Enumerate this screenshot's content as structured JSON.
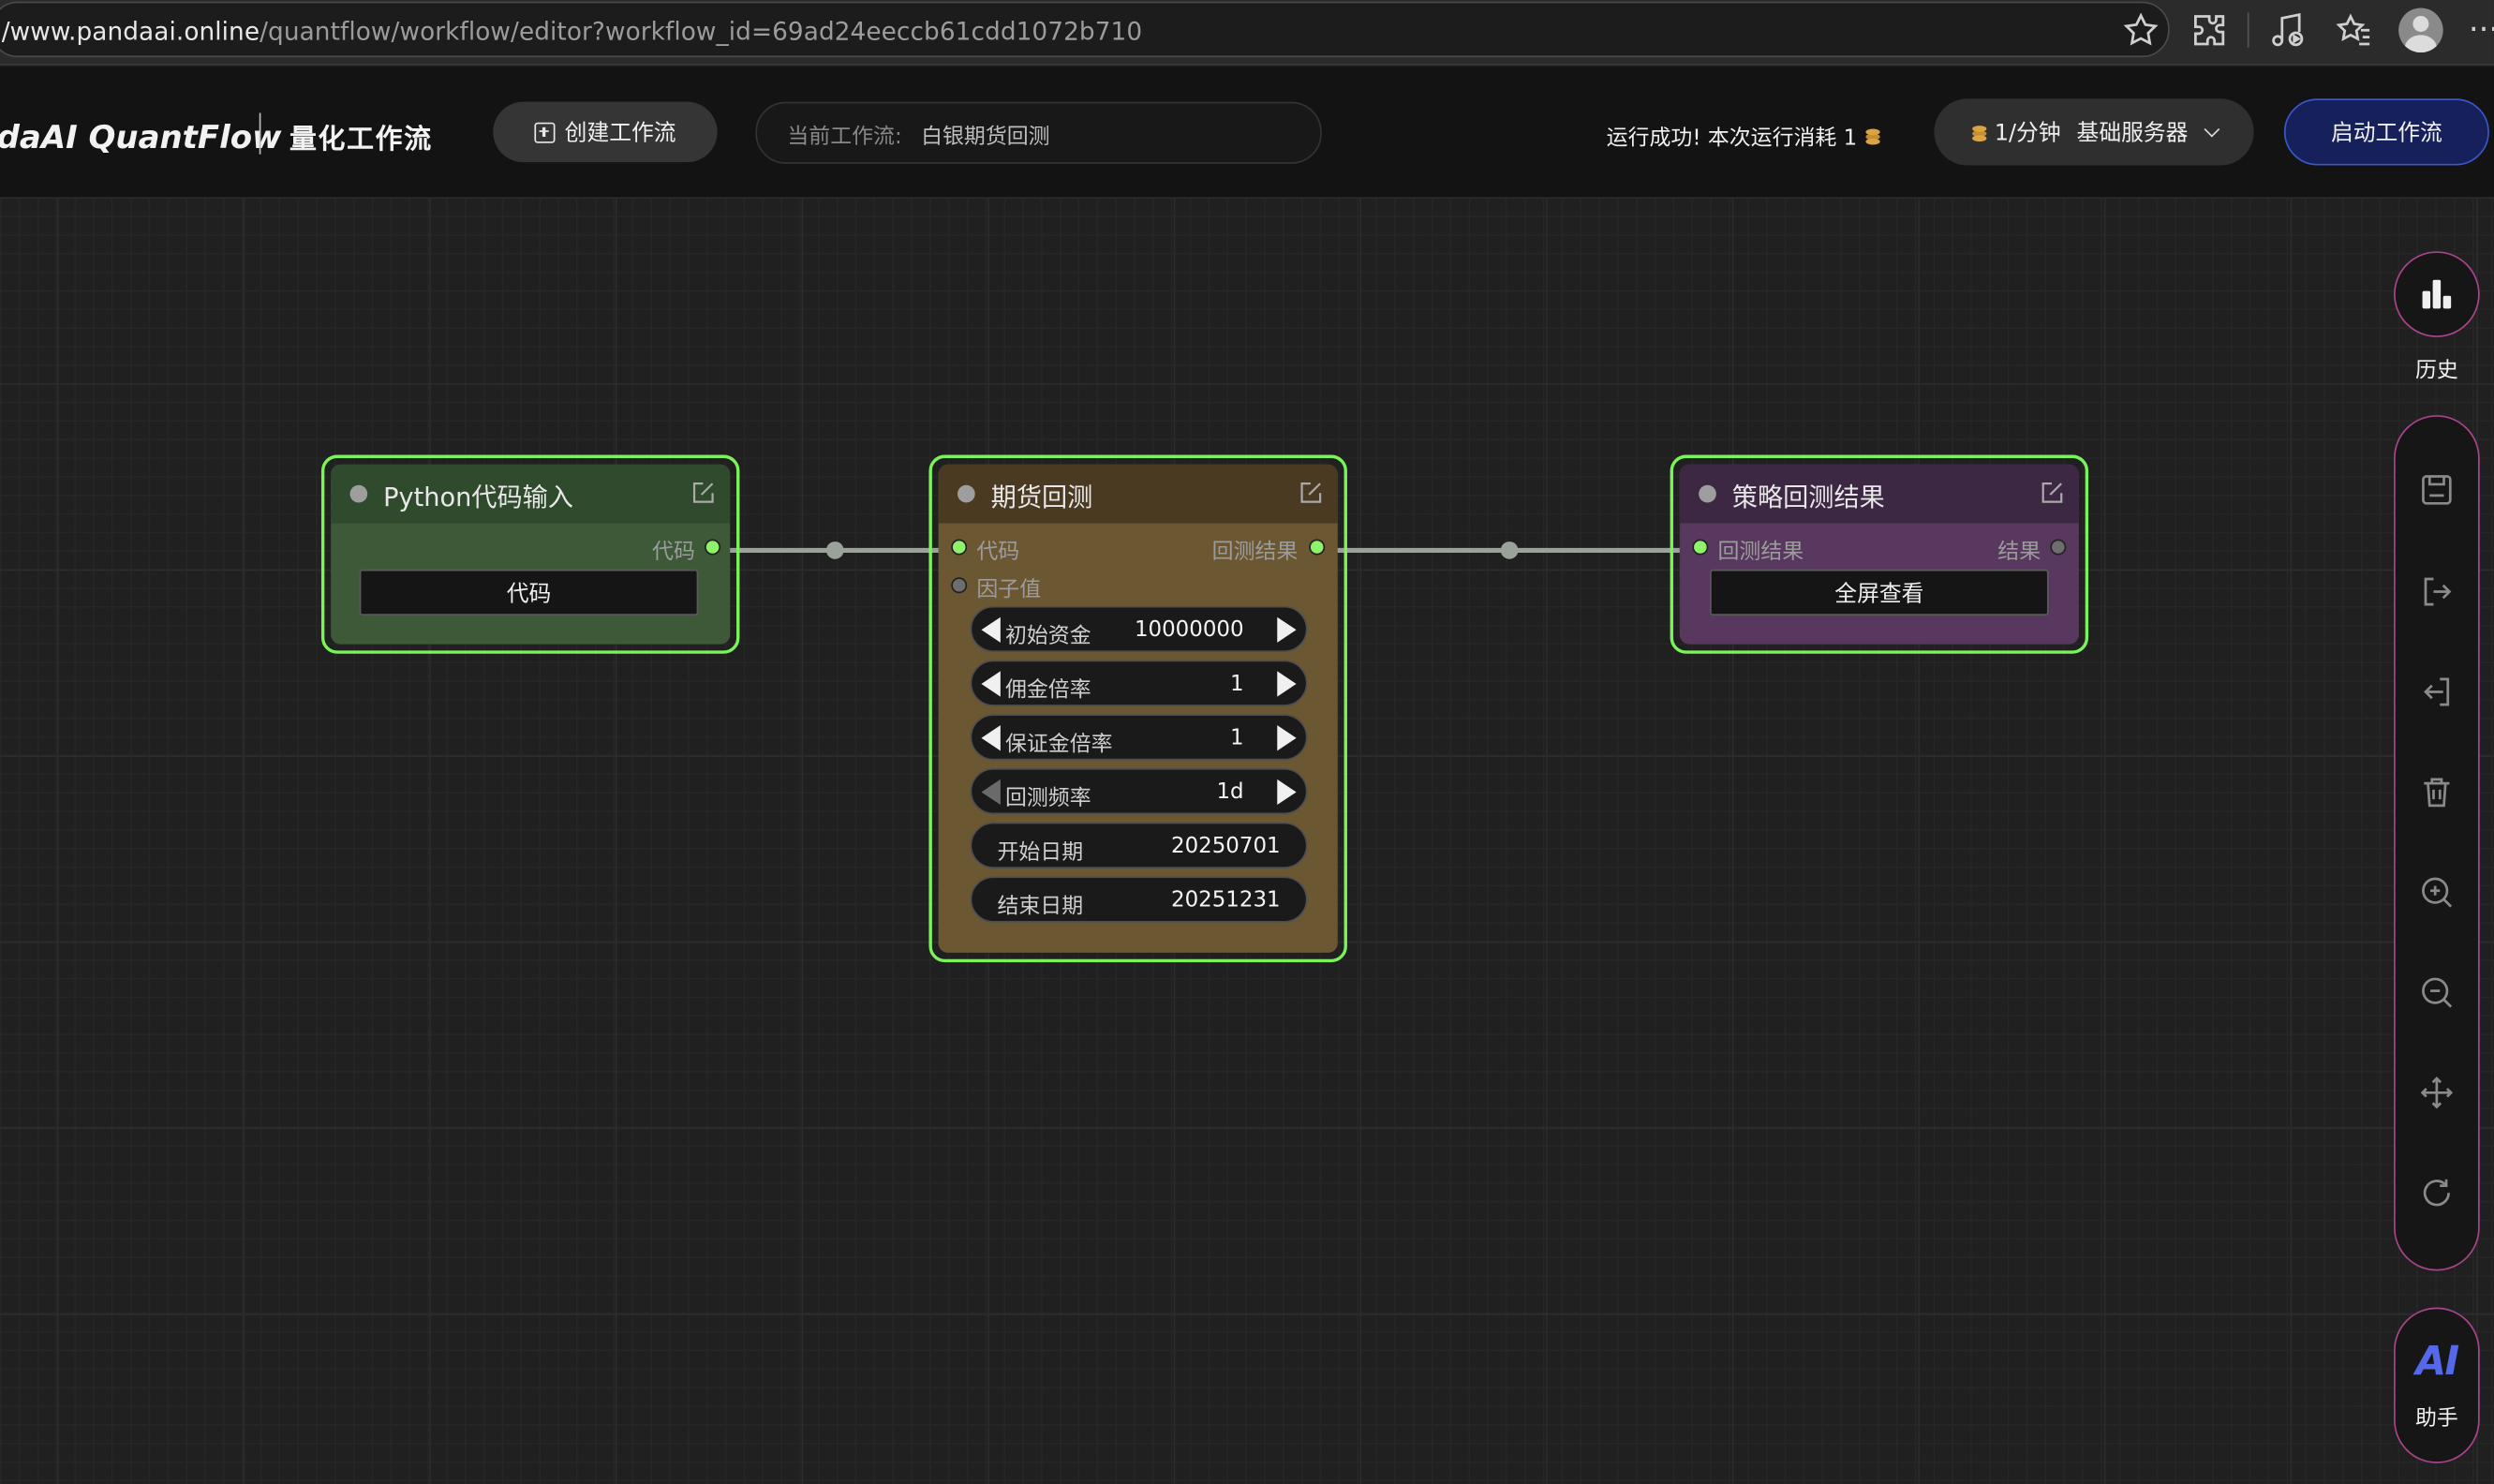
{
  "browser": {
    "url_host": "/www.pandaai.online",
    "url_path": "/quantflow/workflow/editor?workflow_id=69ad24eeccb61cdd1072b710",
    "more": "···"
  },
  "header": {
    "brand": "daAI QuantFlow",
    "subtitle": "量化工作流",
    "create_label": "创建工作流",
    "current_label": "当前工作流:",
    "current_value": "白银期货回测",
    "run_status": "运行成功! 本次运行消耗 1",
    "server_price": "1/分钟",
    "server_tier": "基础服务器",
    "start_label": "启动工作流"
  },
  "nodes": {
    "python": {
      "title": "Python代码输入",
      "output": "代码",
      "button": "代码"
    },
    "future": {
      "title": "期货回测",
      "inputs": [
        "代码",
        "因子值"
      ],
      "output": "回测结果",
      "params": [
        {
          "label": "初始资金",
          "value": "10000000"
        },
        {
          "label": "佣金倍率",
          "value": "1"
        },
        {
          "label": "保证金倍率",
          "value": "1"
        },
        {
          "label": "回测频率",
          "value": "1d"
        },
        {
          "label": "开始日期",
          "value": "20250701"
        },
        {
          "label": "结束日期",
          "value": "20251231"
        }
      ]
    },
    "result": {
      "title": "策略回测结果",
      "input": "回测结果",
      "output": "结果",
      "button": "全屏查看"
    }
  },
  "sidebar": {
    "history_label": "历史",
    "ai_label": "AI",
    "ai_sub": "助手",
    "tools": [
      "save-icon",
      "export-icon",
      "import-icon",
      "trash-icon",
      "zoom-in-icon",
      "zoom-out-icon",
      "move-icon",
      "refresh-icon"
    ]
  },
  "colors": {
    "node_border": "#7cf25a",
    "python_node": "#3d5938",
    "future_node": "#6c5733",
    "result_node": "#58385f",
    "sidebar_accent": "#a8448c",
    "start_button": "#16205a"
  }
}
